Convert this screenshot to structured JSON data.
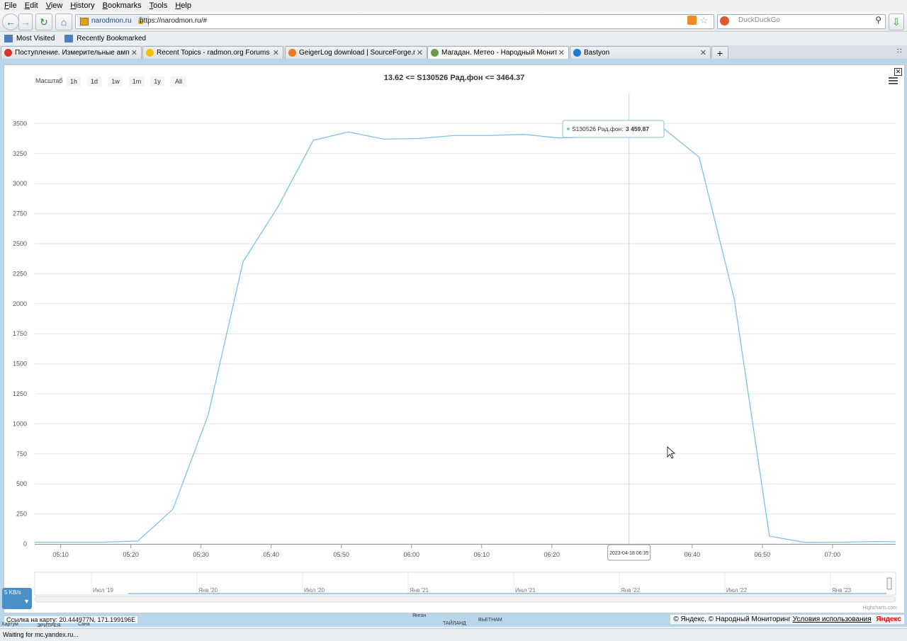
{
  "menu": [
    "File",
    "Edit",
    "View",
    "History",
    "Bookmarks",
    "Tools",
    "Help"
  ],
  "nav": {
    "identity": "narodmon.ru",
    "url": "https://narodmon.ru/#",
    "search_placeholder": "DuckDuckGo"
  },
  "bookmarks": [
    "Most Visited",
    "Recently Bookmarked"
  ],
  "tabs": [
    {
      "label": "Поступление. Измерительные амперм...",
      "favicon_color": "#d9342b"
    },
    {
      "label": "Recent Topics - radmon.org Forums",
      "favicon_color": "#f2c200"
    },
    {
      "label": "GeigerLog download | SourceForge.net",
      "favicon_color": "#f07b1d"
    },
    {
      "label": "Магадан. Метео - Народный Мониторинг",
      "favicon_color": "#6a9a4a"
    },
    {
      "label": "Bastyon",
      "favicon_color": "#1c7bd6"
    }
  ],
  "chart_data": {
    "type": "line",
    "title": "13.62 <= S130526 Рад.фон <= 3464.37",
    "range_label": "Масштаб",
    "range_buttons": [
      "1h",
      "1d",
      "1w",
      "1m",
      "1y",
      "All"
    ],
    "xlabel": "",
    "ylabel": "",
    "ylim": [
      0,
      3750
    ],
    "y_ticks": [
      0,
      250,
      500,
      750,
      1000,
      1250,
      1500,
      1750,
      2000,
      2250,
      2500,
      2750,
      3000,
      3250,
      3500
    ],
    "x_ticks": [
      "05:10",
      "05:20",
      "05:30",
      "05:40",
      "05:50",
      "06:00",
      "06:10",
      "06:20",
      "06:30",
      "06:40",
      "06:50",
      "07:00"
    ],
    "x_min_minutes": 306.3,
    "x_max_minutes": 429,
    "series": [
      {
        "name": "S130526 Рад.фон",
        "color": "#7cc3e6",
        "points": [
          [
            306.3,
            15
          ],
          [
            316,
            15
          ],
          [
            321,
            25
          ],
          [
            326,
            290
          ],
          [
            331,
            1070
          ],
          [
            336,
            2350
          ],
          [
            341,
            2810
          ],
          [
            346,
            3360
          ],
          [
            351,
            3430
          ],
          [
            356,
            3370
          ],
          [
            361,
            3375
          ],
          [
            366,
            3400
          ],
          [
            371,
            3400
          ],
          [
            376,
            3410
          ],
          [
            381,
            3380
          ],
          [
            386,
            3390
          ],
          [
            391,
            3460
          ],
          [
            396,
            3455
          ],
          [
            401,
            3220
          ],
          [
            406,
            2040
          ],
          [
            411,
            65
          ],
          [
            416,
            13.62
          ],
          [
            421,
            15
          ],
          [
            426,
            20
          ],
          [
            429,
            18
          ]
        ]
      }
    ],
    "tooltip": {
      "series": "S130526 Рад.фон",
      "value": "3 459.87",
      "x_minutes": 391,
      "time_label": "2023-04-18 06:35"
    },
    "navigator_labels": [
      "Июл '19",
      "Янв '20",
      "Июл '20",
      "Янв '21",
      "Июл '21",
      "Янв '22",
      "Июл '22",
      "Янв '23"
    ],
    "credits": "Highcharts.com"
  },
  "map": {
    "coords_text": "Ссылка на карту: 20.444977N, 171.199196E",
    "copyright_text": "© Яндекс, © Народный Мониторинг",
    "terms_link": "Условия использования",
    "brand": "Яндекс",
    "place_labels": [
      "Хартум",
      "ЭРИТРЕЯ",
      "Сана",
      "Янгон",
      "ТАЙЛАНД",
      "ВЬЕТНАМ"
    ]
  },
  "speed_label": "5 KB/s",
  "status_text": "Waiting for mc.yandex.ru..."
}
